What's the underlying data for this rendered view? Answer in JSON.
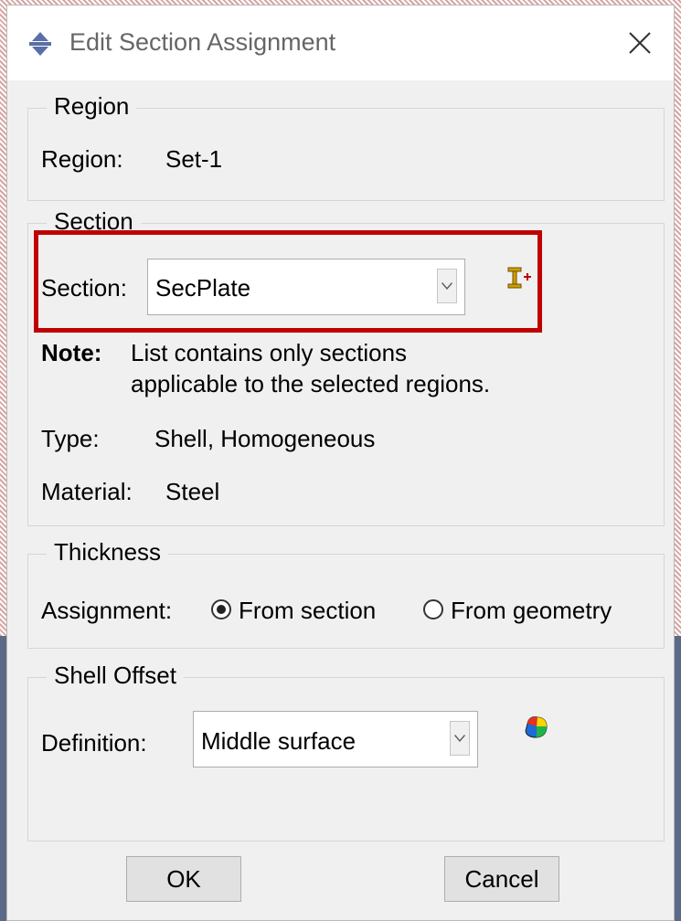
{
  "window": {
    "title": "Edit Section Assignment"
  },
  "region": {
    "legend": "Region",
    "label": "Region:",
    "value": "Set-1"
  },
  "section": {
    "legend": "Section",
    "label": "Section:",
    "selected": "SecPlate",
    "note_label": "Note:",
    "note_line1": "List contains only sections",
    "note_line2": "applicable to the selected regions.",
    "type_label": "Type:",
    "type_value": "Shell, Homogeneous",
    "material_label": "Material:",
    "material_value": "Steel",
    "highlight_color": "#c00000"
  },
  "thickness": {
    "legend": "Thickness",
    "label": "Assignment:",
    "option_section": "From section",
    "option_geometry": "From geometry",
    "selected": "From section"
  },
  "shell_offset": {
    "legend": "Shell Offset",
    "label": "Definition:",
    "selected": "Middle surface"
  },
  "buttons": {
    "ok": "OK",
    "cancel": "Cancel"
  },
  "icons": {
    "app": "abaqus-app-icon",
    "close": "close-icon",
    "create_section": "create-section-icon",
    "offset_surface": "offset-surface-icon"
  }
}
